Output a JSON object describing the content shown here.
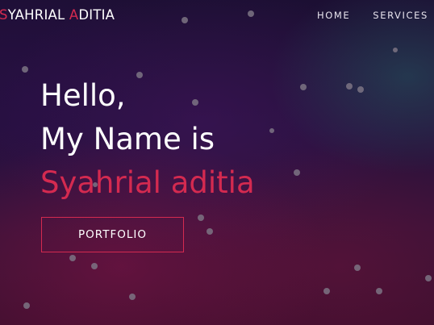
{
  "brand": {
    "part1_accent": "S",
    "part1_rest": "YAHRIAL ",
    "part2_accent": "A",
    "part2_rest": "DITIA"
  },
  "nav": {
    "items": [
      {
        "label": "HOME"
      },
      {
        "label": "SERVICES"
      }
    ]
  },
  "hero": {
    "line1": "Hello,",
    "line2": "My Name is",
    "name": "Syahrial aditia",
    "button_label": "PORTFOLIO"
  },
  "colors": {
    "accent": "#d42a50",
    "text": "#ffffff",
    "particle": "#7c7484"
  }
}
